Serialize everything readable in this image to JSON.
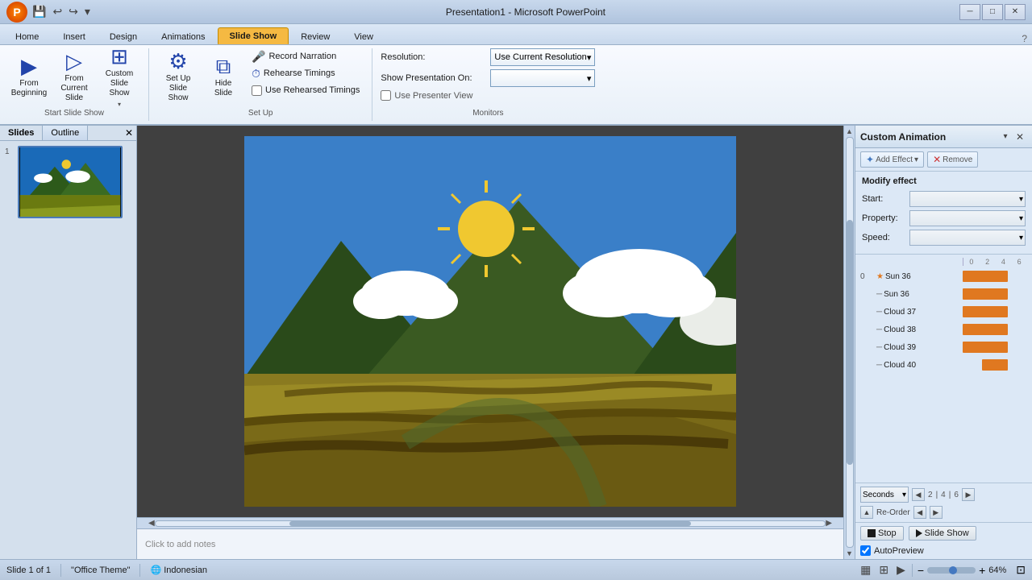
{
  "window": {
    "title": "Presentation1 - Microsoft PowerPoint"
  },
  "title_bar": {
    "quick_access": [
      "💾",
      "↩",
      "↪",
      "▾"
    ]
  },
  "ribbon_tabs": {
    "tabs": [
      "Home",
      "Insert",
      "Design",
      "Animations",
      "Slide Show",
      "Review",
      "View"
    ],
    "active": "Slide Show",
    "active_index": 4
  },
  "ribbon": {
    "groups": {
      "start_slide_show": {
        "label": "Start Slide Show",
        "buttons": [
          {
            "id": "from-beginning",
            "label": "From\nBeginning",
            "icon": "▶"
          },
          {
            "id": "from-current",
            "label": "From\nCurrent Slide",
            "icon": "▷"
          },
          {
            "id": "custom-slide-show",
            "label": "Custom\nSlide Show",
            "icon": "⊞",
            "has_arrow": true
          }
        ]
      },
      "set_up": {
        "label": "Set Up",
        "buttons": [
          {
            "id": "set-up-slide-show",
            "label": "Set Up\nSlide Show",
            "icon": "⚙"
          },
          {
            "id": "hide-slide",
            "label": "Hide\nSlide",
            "icon": "⧉"
          }
        ],
        "small_buttons": [
          {
            "id": "record-narration",
            "label": "Record Narration",
            "icon": "🎤"
          },
          {
            "id": "rehearse-timings",
            "label": "Rehearse Timings",
            "icon": "⏱"
          },
          {
            "id": "use-rehearsed-timings",
            "label": "Use Rehearsed Timings",
            "checked": false
          }
        ]
      },
      "monitors": {
        "label": "Monitors",
        "resolution_label": "Resolution:",
        "resolution_value": "Use Current Resolution",
        "show_on_label": "Show Presentation On:",
        "show_on_value": "",
        "use_presenter_view": "Use Presenter View",
        "use_presenter_checked": false
      }
    }
  },
  "panel_tabs": {
    "slides": "Slides",
    "outline": "Outline"
  },
  "notes_placeholder": "Click to add notes",
  "custom_animation": {
    "title": "Custom Animation",
    "add_effect_label": "Add Effect",
    "remove_label": "Remove",
    "modify_effect": "Modify effect",
    "start_label": "Start:",
    "property_label": "Property:",
    "speed_label": "Speed:",
    "items": [
      {
        "order": "0",
        "type": "star",
        "name": "Sun 36"
      },
      {
        "order": "",
        "type": "line",
        "name": "Sun 36"
      },
      {
        "order": "",
        "type": "line",
        "name": "Cloud 37"
      },
      {
        "order": "",
        "type": "line",
        "name": "Cloud 38"
      },
      {
        "order": "",
        "type": "line",
        "name": "Cloud 39"
      },
      {
        "order": "",
        "type": "line",
        "name": "Cloud 40"
      }
    ],
    "timeline": {
      "seconds_label": "Seconds",
      "values": [
        "2",
        "4",
        "6"
      ],
      "nav_prev": "◀",
      "nav_next": "▶",
      "reorder_up": "Re-Order",
      "reorder_prev": "◀",
      "reorder_next": "▶"
    },
    "stop_label": "Stop",
    "slide_show_label": "Slide Show",
    "autopreview_label": "AutoPreview",
    "autopreview_checked": true
  },
  "status_bar": {
    "slide_info": "Slide 1 of 1",
    "theme": "\"Office Theme\"",
    "language": "Indonesian",
    "zoom_level": "64%"
  }
}
